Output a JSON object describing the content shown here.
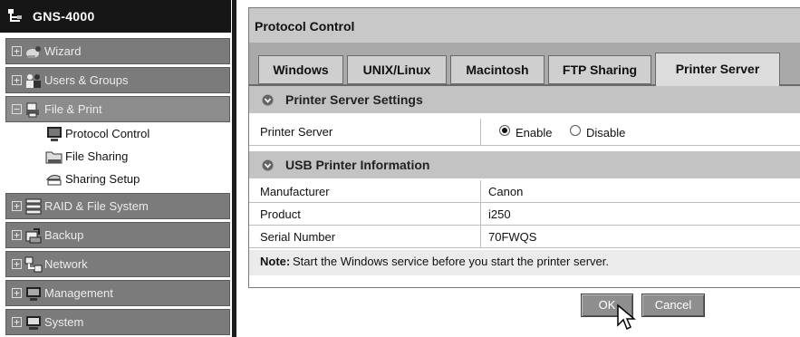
{
  "sidebar": {
    "title": "GNS-4000",
    "items": [
      {
        "label": "Wizard",
        "icon": "wizard-icon",
        "expander": "+"
      },
      {
        "label": "Users & Groups",
        "icon": "users-groups-icon",
        "expander": "+"
      },
      {
        "label": "File & Print",
        "icon": "file-print-icon",
        "expander": "−"
      },
      {
        "label": "RAID & File System",
        "icon": "raid-icon",
        "expander": "+"
      },
      {
        "label": "Backup",
        "icon": "backup-icon",
        "expander": "+"
      },
      {
        "label": "Network",
        "icon": "network-icon",
        "expander": "+"
      },
      {
        "label": "Management",
        "icon": "management-icon",
        "expander": "+"
      },
      {
        "label": "System",
        "icon": "system-icon",
        "expander": "+"
      }
    ],
    "sub_items": [
      {
        "label": "Protocol Control",
        "icon": "monitor-icon"
      },
      {
        "label": "File Sharing",
        "icon": "folder-icon"
      },
      {
        "label": "Sharing Setup",
        "icon": "sharing-hand-icon"
      }
    ]
  },
  "panel": {
    "title": "Protocol Control",
    "tabs": [
      "Windows",
      "UNIX/Linux",
      "Macintosh",
      "FTP Sharing",
      "Printer Server"
    ],
    "active_tab": "Printer Server",
    "printer_section": {
      "heading": "Printer Server Settings",
      "row_label": "Printer Server",
      "enable_label": "Enable",
      "disable_label": "Disable",
      "selected": "Enable"
    },
    "usb_section": {
      "heading": "USB Printer Information",
      "rows": [
        {
          "label": "Manufacturer",
          "value": "Canon"
        },
        {
          "label": "Product",
          "value": "i250"
        },
        {
          "label": "Serial Number",
          "value": "70FWQS"
        }
      ]
    },
    "note": {
      "key": "Note:",
      "text": "Start the Windows service before you start the printer server."
    }
  },
  "buttons": {
    "ok": "OK",
    "cancel": "Cancel"
  },
  "colors": {
    "header_bg": "#161616",
    "nav_item_bg": "#7b7b7b",
    "section_bg": "#c3c3c3",
    "tabstrip_bg": "#a9a9a9"
  }
}
